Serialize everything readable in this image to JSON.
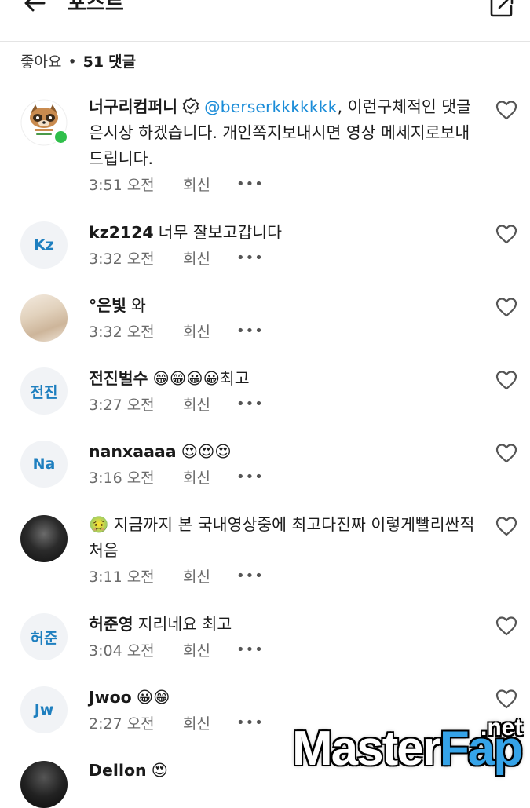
{
  "header": {
    "title": "포스트"
  },
  "summary": {
    "likes": "좋아요",
    "separator": "•",
    "count": "51",
    "comments_label": "댓글"
  },
  "icons": {
    "back": "arrow-left-icon",
    "edit": "edit-external-icon",
    "like": "heart-outline-icon",
    "verified": "verified-badge-icon"
  },
  "colors": {
    "mention": "#1a8cd8",
    "avatar_text": "#1e7fbf",
    "online": "#2fbf4a"
  },
  "comments": [
    {
      "author": "너구리컴퍼니",
      "mention": "@berserkkkkkkk",
      "text": ", 이런구체적인 댓글은시상 하겠습니다. 개인쪽지보내시면 영상 메세지로보내드립니다.",
      "time": "3:51 오전",
      "reply": "회신",
      "more": "•••"
    },
    {
      "author": "kz2124",
      "avatar": "Kz",
      "text": "너무 잘보고갑니다",
      "time": "3:32 오전",
      "reply": "회신",
      "more": "•••"
    },
    {
      "author": "°은빛",
      "text": "와",
      "time": "3:32 오전",
      "reply": "회신",
      "more": "•••"
    },
    {
      "author": "전진벌수",
      "avatar": "전진",
      "text": "😁😁😀😀최고",
      "time": "3:27 오전",
      "reply": "회신",
      "more": "•••"
    },
    {
      "author": "nanxaaaa",
      "avatar": "Na",
      "text": "😍😍😍",
      "time": "3:16 오전",
      "reply": "회신",
      "more": "•••"
    },
    {
      "author": "🤢",
      "text": "지금까지 본 국내영상중에 최고다진짜 이렇게빨리싼적 처음",
      "time": "3:11 오전",
      "reply": "회신",
      "more": "•••"
    },
    {
      "author": "허준영",
      "avatar": "허준",
      "text": "지리네요 최고",
      "time": "3:04 오전",
      "reply": "회신",
      "more": "•••"
    },
    {
      "author": "Jwoo",
      "avatar": "Jw",
      "text": "😀😁",
      "time": "2:27 오전",
      "reply": "회신",
      "more": "•••"
    },
    {
      "author": "Dellon",
      "text": "😍"
    }
  ],
  "watermark": {
    "part1": "Master",
    "part2": "Fap",
    "suffix": ".net"
  }
}
